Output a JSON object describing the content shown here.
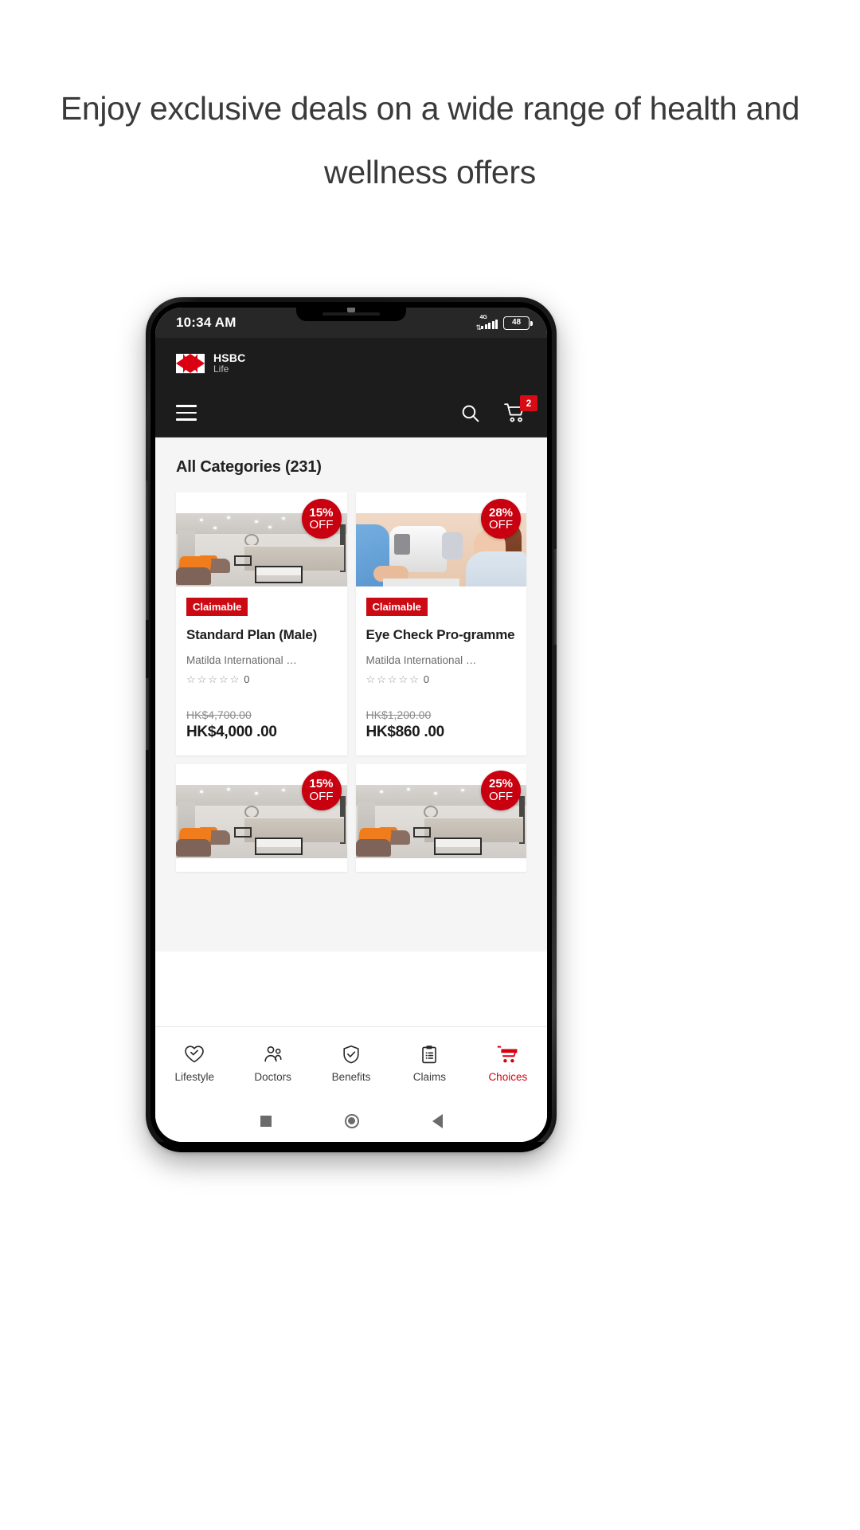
{
  "headline": "Enjoy exclusive deals on a wide range of health and wellness offers",
  "status_bar": {
    "time": "10:34 AM",
    "network": "4G",
    "battery_level": "48"
  },
  "brand": {
    "name": "HSBC",
    "sub": "Life",
    "logo_color": "#db0011"
  },
  "nav": {
    "menu_icon": "hamburger-icon",
    "search_icon": "search-icon",
    "cart_icon": "cart-icon",
    "cart_count": "2",
    "badge_color": "#d60b16"
  },
  "main": {
    "category_title": "All Categories (231)",
    "cards": [
      {
        "discount_pct": "15%",
        "discount_off": "OFF",
        "badge": "Claimable",
        "title": "Standard Plan (Male)",
        "merchant": "Matilda International …",
        "stars": "☆☆☆☆☆",
        "rating_count": "0",
        "price_old": "HK$4,700.00",
        "price_new": "HK$4,000 .00",
        "image": "clinic-waiting-room"
      },
      {
        "discount_pct": "28%",
        "discount_off": "OFF",
        "badge": "Claimable",
        "title": "Eye Check Pro-gramme",
        "merchant": "Matilda International …",
        "stars": "☆☆☆☆☆",
        "rating_count": "0",
        "price_old": "HK$1,200.00",
        "price_new": "HK$860 .00",
        "image": "eye-examination"
      }
    ],
    "cards_row2": [
      {
        "discount_pct": "15%",
        "discount_off": "OFF",
        "image": "clinic-waiting-room"
      },
      {
        "discount_pct": "25%",
        "discount_off": "OFF",
        "image": "clinic-waiting-room"
      }
    ]
  },
  "tabbar": {
    "items": [
      {
        "label": "Lifestyle",
        "icon": "heart-check-icon",
        "active": false
      },
      {
        "label": "Doctors",
        "icon": "doctors-icon",
        "active": false
      },
      {
        "label": "Benefits",
        "icon": "shield-check-icon",
        "active": false
      },
      {
        "label": "Claims",
        "icon": "clipboard-icon",
        "active": false
      },
      {
        "label": "Choices",
        "icon": "cart-icon",
        "active": true
      }
    ],
    "active_color": "#d6000f"
  },
  "system_nav": {
    "recents_icon": "square-icon",
    "home_icon": "circle-icon",
    "back_icon": "triangle-left-icon"
  }
}
